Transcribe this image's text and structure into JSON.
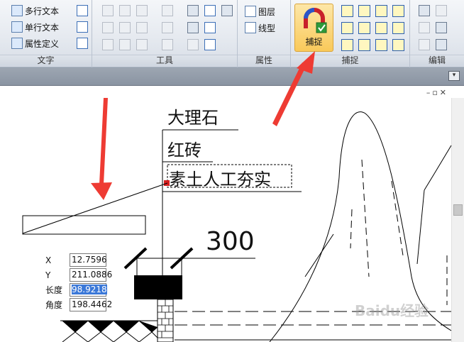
{
  "ribbon": {
    "groups": {
      "text": {
        "label": "文字",
        "buttons": [
          "多行文本",
          "单行文本",
          "属性定义"
        ]
      },
      "tools": {
        "label": "工具"
      },
      "properties": {
        "label": "属性",
        "buttons": [
          "图层",
          "线型"
        ]
      },
      "snap": {
        "label": "捕捉",
        "button": "捕捉"
      },
      "edit": {
        "label": "编辑"
      }
    }
  },
  "drawing": {
    "labels": [
      "大理石",
      "红砖",
      "素土人工夯实"
    ],
    "dimension": "300"
  },
  "coords": {
    "rows": [
      {
        "label": "X",
        "value": "12.7596"
      },
      {
        "label": "Y",
        "value": "211.0886"
      },
      {
        "label": "长度",
        "value": "98.9218"
      },
      {
        "label": "角度",
        "value": "198.4462"
      }
    ]
  },
  "watermark": "Baidu经验",
  "colors": {
    "arrow": "#ee3b33",
    "snap_bg": "#f9c95a",
    "grip": "#d61f1f"
  }
}
